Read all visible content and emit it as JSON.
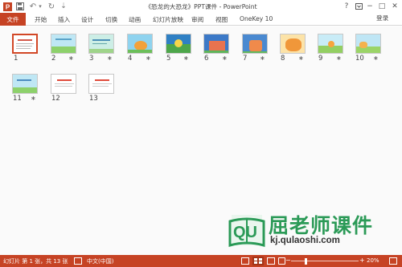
{
  "window": {
    "title": "《恐龙的大恐龙》PPT课件 - PowerPoint",
    "help_icon": "?",
    "ribbon_display_icon": "ribbon-display-options-icon",
    "minimize_icon": "−",
    "restore_icon": "□",
    "close_icon": "✕"
  },
  "quick_access": {
    "undo_icon": "↶",
    "dropdown_icon": "▾",
    "redo_icon": "↻",
    "save_icon": "save-icon",
    "customize_icon": "⇣"
  },
  "ribbon": {
    "file_label": "文件",
    "tabs": [
      "开始",
      "插入",
      "设计",
      "切换",
      "动画",
      "幻灯片放映",
      "审阅",
      "视图",
      "OneKey 10"
    ],
    "login_label": "登录"
  },
  "slides": [
    {
      "number": "1",
      "star": "",
      "selected": true
    },
    {
      "number": "2",
      "star": "∗"
    },
    {
      "number": "3",
      "star": "∗"
    },
    {
      "number": "4",
      "star": "∗"
    },
    {
      "number": "5",
      "star": "∗"
    },
    {
      "number": "6",
      "star": "∗"
    },
    {
      "number": "7",
      "star": "∗"
    },
    {
      "number": "8",
      "star": "∗"
    },
    {
      "number": "9",
      "star": "∗"
    },
    {
      "number": "10",
      "star": "∗"
    },
    {
      "number": "11",
      "star": "∗"
    },
    {
      "number": "12",
      "star": ""
    },
    {
      "number": "13",
      "star": ""
    }
  ],
  "status": {
    "slide_info": "幻灯片 第 1 张，共 13 张",
    "language": "中文(中国)",
    "zoom_out": "−",
    "zoom_in": "+",
    "zoom_level": "20%",
    "zoom_fraction": 0.2
  },
  "watermark": {
    "logo_text": "QU",
    "brand": "屈老师课件",
    "url": "kj.qulaoshi.com"
  },
  "colors": {
    "accent": "#c64324",
    "selected_border": "#d24726"
  }
}
